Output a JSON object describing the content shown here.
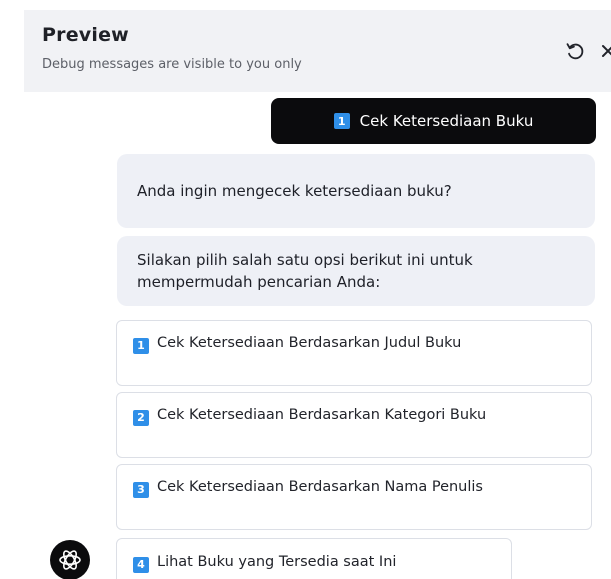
{
  "header": {
    "title": "Preview",
    "subtitle": "Debug messages are visible to you only",
    "icons": [
      "refresh-icon",
      "close-icon"
    ]
  },
  "user_message": {
    "number": "1",
    "text": "Cek Ketersediaan Buku"
  },
  "bot_messages": [
    {
      "text": "Anda ingin mengecek ketersediaan buku?"
    },
    {
      "text": "Silakan pilih salah satu opsi berikut ini untuk mempermudah pencarian Anda:"
    }
  ],
  "options": [
    {
      "number": "1",
      "label": "Cek Ketersediaan Berdasarkan Judul Buku"
    },
    {
      "number": "2",
      "label": "Cek Ketersediaan Berdasarkan Kategori Buku"
    },
    {
      "number": "3",
      "label": "Cek Ketersediaan Berdasarkan Nama Penulis"
    },
    {
      "number": "4",
      "label": "Lihat Buku yang Tersedia saat Ini"
    }
  ],
  "colors": {
    "header_bg": "#f1f2f5",
    "user_bubble_bg": "#0b0b0d",
    "bot_bubble_bg": "#eef0f6",
    "number_badge": "#2f8fe8"
  },
  "avatar_icon": "bot-logo-icon"
}
